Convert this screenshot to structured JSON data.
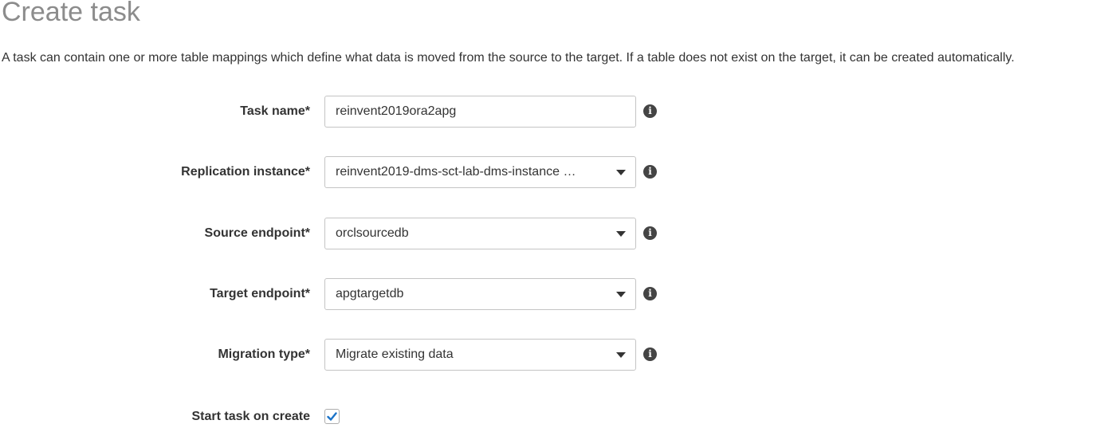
{
  "page": {
    "title": "Create task",
    "description": "A task can contain one or more table mappings which define what data is moved from the source to the target. If a table does not exist on the target, it can be created automatically."
  },
  "form": {
    "task_name": {
      "label": "Task name*",
      "value": "reinvent2019ora2apg"
    },
    "replication_instance": {
      "label": "Replication instance*",
      "value": "reinvent2019-dms-sct-lab-dms-instance …"
    },
    "source_endpoint": {
      "label": "Source endpoint*",
      "value": "orclsourcedb"
    },
    "target_endpoint": {
      "label": "Target endpoint*",
      "value": "apgtargetdb"
    },
    "migration_type": {
      "label": "Migration type*",
      "value": "Migrate existing data"
    },
    "start_task": {
      "label": "Start task on create",
      "checked": true
    }
  },
  "icons": {
    "info": "info-icon",
    "dropdown": "caret-down-icon",
    "check": "checkmark-icon"
  },
  "colors": {
    "title": "#8c8c8c",
    "text": "#333333",
    "border": "#c4c4c4",
    "check": "#1a73c8",
    "info_bg": "#444444"
  }
}
